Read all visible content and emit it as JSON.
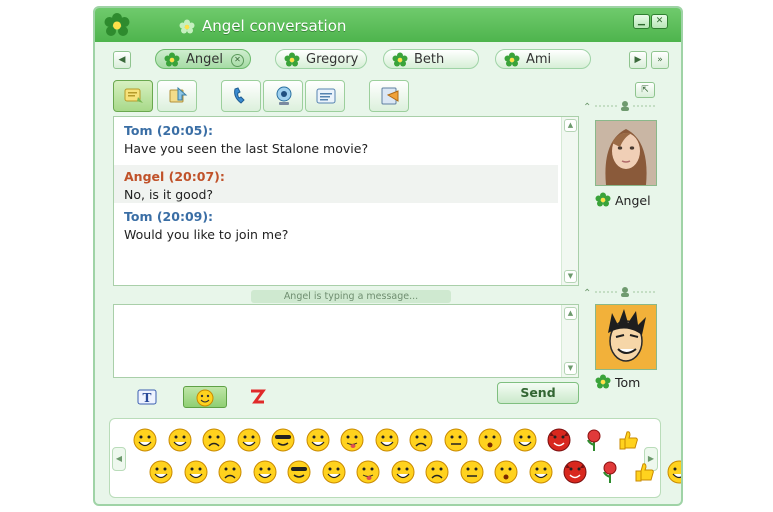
{
  "window": {
    "title": "Angel conversation",
    "colors": {
      "accent": "#4eb44d",
      "frame": "#9fd3a6",
      "tom": "#3a6ea5",
      "angel": "#c0522a"
    }
  },
  "tabs": [
    {
      "label": "Angel",
      "active": true
    },
    {
      "label": "Gregory",
      "active": false
    },
    {
      "label": "Beth",
      "active": false
    },
    {
      "label": "Ami",
      "active": false
    }
  ],
  "toolbar": {
    "icons": [
      "message-icon",
      "file-transfer-icon",
      "phone-icon",
      "webcam-icon",
      "contact-card-icon",
      "history-icon"
    ]
  },
  "messages": [
    {
      "sender": "Tom (20:05):",
      "text": "Have you seen the last Stalone movie?",
      "who": "tom"
    },
    {
      "sender": "Angel (20:07):",
      "text": "No, is it good?",
      "who": "angel"
    },
    {
      "sender": "Tom (20:09):",
      "text": "Would you like to join me?",
      "who": "tom"
    }
  ],
  "status": {
    "typing": "Angel is typing a message..."
  },
  "input": {
    "placeholder": ""
  },
  "participants": {
    "remote": {
      "name": "Angel"
    },
    "local": {
      "name": "Tom"
    }
  },
  "compose": {
    "send_label": "Send",
    "format_tools": [
      "text-format-icon",
      "smiley-icon",
      "nudge-icon"
    ]
  },
  "emoticons": {
    "count": 31
  }
}
